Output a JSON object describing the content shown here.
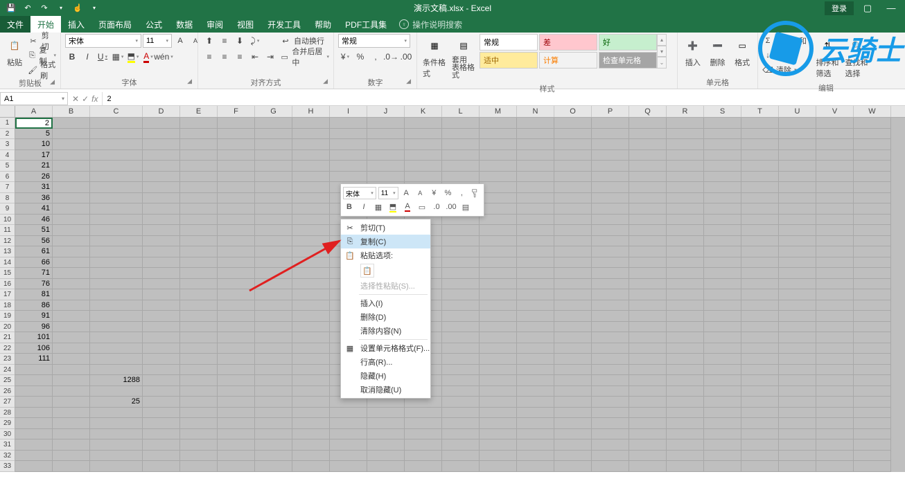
{
  "titlebar": {
    "title": "演示文稿.xlsx - Excel",
    "login": "登录"
  },
  "tabs": {
    "file": "文件",
    "items": [
      "开始",
      "插入",
      "页面布局",
      "公式",
      "数据",
      "审阅",
      "视图",
      "开发工具",
      "帮助",
      "PDF工具集"
    ],
    "active_index": 0,
    "tell_me": "操作说明搜索"
  },
  "ribbon": {
    "clipboard": {
      "label": "剪贴板",
      "paste": "粘贴",
      "cut": "剪切",
      "copy": "复制",
      "painter": "格式刷"
    },
    "font": {
      "label": "字体",
      "name": "宋体",
      "size": "11",
      "buttons": {
        "bold": "B",
        "italic": "I",
        "underline": "U"
      }
    },
    "alignment": {
      "label": "对齐方式",
      "wrap": "自动换行",
      "merge": "合并后居中"
    },
    "number": {
      "label": "数字",
      "format": "常规"
    },
    "styles": {
      "label": "样式",
      "conditional": "条件格式",
      "table": "套用\n表格格式",
      "gallery": [
        "常规",
        "差",
        "好",
        "适中",
        "计算",
        "检查单元格"
      ]
    },
    "cells": {
      "label": "单元格",
      "insert": "插入",
      "delete": "删除",
      "format": "格式"
    },
    "editing": {
      "label": "编辑",
      "sum": "自动求和",
      "fill": "填充",
      "clear": "清除",
      "sort": "排序和筛选",
      "find": "查找和选择"
    }
  },
  "namebox": "A1",
  "formula": "2",
  "columns": [
    "A",
    "B",
    "C",
    "D",
    "E",
    "F",
    "G",
    "H",
    "I",
    "J",
    "K",
    "L",
    "M",
    "N",
    "O",
    "P",
    "Q",
    "R",
    "S",
    "T",
    "U",
    "V",
    "W"
  ],
  "col_widths": {
    "default": 54,
    "C": 76
  },
  "rows_shown": 33,
  "cells": {
    "A": [
      2,
      5,
      10,
      17,
      21,
      26,
      31,
      36,
      41,
      46,
      51,
      56,
      61,
      66,
      71,
      76,
      81,
      86,
      91,
      96,
      101,
      106,
      111
    ],
    "C25": 1288,
    "C27": 25
  },
  "mini_toolbar": {
    "font": "宋体",
    "size": "11"
  },
  "context_menu": {
    "items": [
      {
        "label": "剪切(T)",
        "icon": "cut"
      },
      {
        "label": "复制(C)",
        "icon": "copy",
        "hover": true
      },
      {
        "label": "粘贴选项:",
        "icon": "paste-header"
      },
      {
        "type": "paste-icons"
      },
      {
        "label": "选择性粘贴(S)...",
        "disabled": true
      },
      {
        "type": "sep"
      },
      {
        "label": "插入(I)"
      },
      {
        "label": "删除(D)"
      },
      {
        "label": "清除内容(N)"
      },
      {
        "type": "sep"
      },
      {
        "label": "设置单元格格式(F)...",
        "icon": "format"
      },
      {
        "label": "行高(R)..."
      },
      {
        "label": "隐藏(H)"
      },
      {
        "label": "取消隐藏(U)"
      }
    ]
  },
  "watermark": "云骑士"
}
